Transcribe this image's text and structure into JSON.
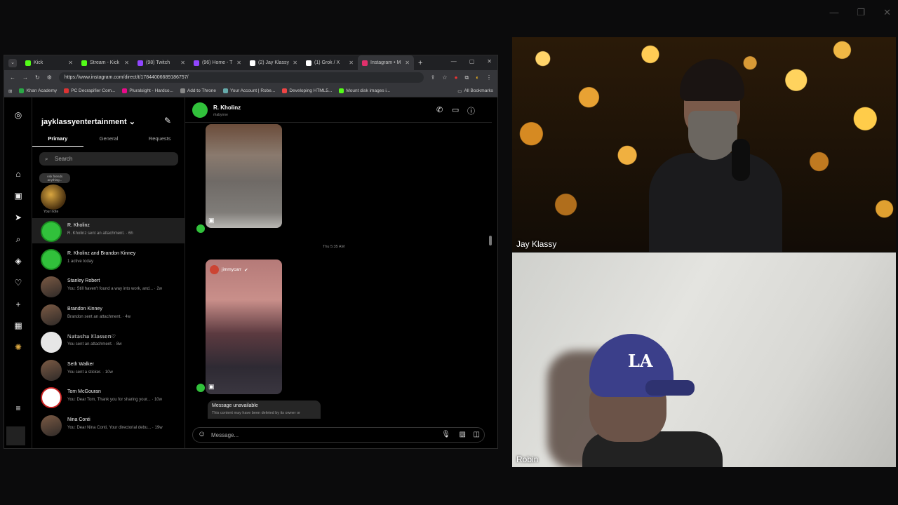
{
  "window_controls": {
    "minimize": "—",
    "restore": "❐",
    "close": "✕"
  },
  "browser": {
    "tabs": [
      {
        "label": "Kick",
        "color": "#53fc18",
        "active": false
      },
      {
        "label": "Stream - Kick",
        "color": "#53fc18",
        "active": false
      },
      {
        "label": "(98) Twitch",
        "color": "#9146ff",
        "active": false
      },
      {
        "label": "(96) Home - T",
        "color": "#9146ff",
        "active": false
      },
      {
        "label": "(2) Jay Klassy",
        "color": "#ffffff",
        "active": false
      },
      {
        "label": "(1) Grok / X",
        "color": "#ffffff",
        "active": false
      },
      {
        "label": "Instagram • M",
        "color": "#e1306c",
        "active": true
      }
    ],
    "url": "https://www.instagram.com/direct/t/17844006689186757/",
    "bookmarks": [
      {
        "label": "Khan Academy",
        "color": "#2aa846"
      },
      {
        "label": "PC Decrapifier Com...",
        "color": "#d33"
      },
      {
        "label": "Pluralsight - Hardco...",
        "color": "#e80a89"
      },
      {
        "label": "Add to Throne",
        "color": "#888"
      },
      {
        "label": "Your Account | Robe...",
        "color": "#6aa"
      },
      {
        "label": "Developing HTML5...",
        "color": "#e44"
      },
      {
        "label": "Mount disk images i...",
        "color": "#53fc18"
      }
    ],
    "all_bookmarks": "All Bookmarks"
  },
  "instagram": {
    "account": "jayklassyentertainment",
    "inbox_tabs": [
      "Primary",
      "General",
      "Requests"
    ],
    "search_placeholder": "Search",
    "note": {
      "bubble": "Ask friends anything...",
      "label": "Your note"
    },
    "conversations": [
      {
        "name": "R. Kholinz",
        "preview": "R. Kholinz sent an attachment. · 6h",
        "avatar": "green",
        "selected": true
      },
      {
        "name": "R. Kholinz and Brandon Kinney",
        "preview": "1 active today",
        "avatar": "green",
        "selected": false
      },
      {
        "name": "Stanley Robert",
        "preview": "You: Still haven't found a way into work, and... · 2w",
        "avatar": "face",
        "selected": false
      },
      {
        "name": "Brandon Kinney",
        "preview": "Brandon sent an attachment. · 4w",
        "avatar": "face",
        "selected": false
      },
      {
        "name": "ℕ𝕒𝕥𝕒𝕤𝕙𝕒 𝕂𝕝𝕒𝕤𝕤𝕖𝕟♡",
        "preview": "You sent an attachment. · 8w",
        "avatar": "white",
        "selected": false
      },
      {
        "name": "Seth Walker",
        "preview": "You sent a sticker. · 10w",
        "avatar": "face",
        "selected": false
      },
      {
        "name": "Tom McGouran",
        "preview": "You: Dear Tom, Thank you for sharing your... · 10w",
        "avatar": "badge",
        "selected": false
      },
      {
        "name": "Nina Conti",
        "preview": "You: Dear Nina Conti, Your directorial debu... · 19w",
        "avatar": "face",
        "selected": false
      }
    ],
    "chat": {
      "name": "R. Kholinz",
      "username": "rhabynne",
      "timestamp": "Thu 5:35 AM",
      "shared_caption": "jimmycarr",
      "unavailable_title": "Message unavailable",
      "unavailable_body": "This content may have been deleted by its owner or",
      "composer_placeholder": "Message..."
    }
  },
  "webcams": [
    {
      "label": "Jay Klassy"
    },
    {
      "label": "Robin"
    }
  ]
}
